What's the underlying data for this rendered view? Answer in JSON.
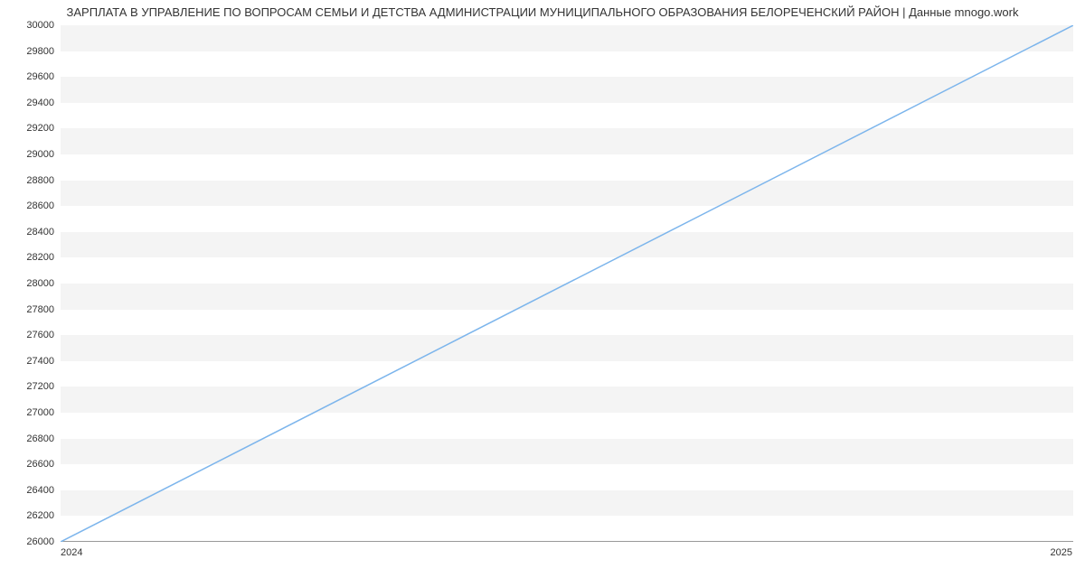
{
  "chart_data": {
    "type": "line",
    "title": "ЗАРПЛАТА В УПРАВЛЕНИЕ ПО ВОПРОСАМ СЕМЬИ И ДЕТСТВА АДМИНИСТРАЦИИ МУНИЦИПАЛЬНОГО ОБРАЗОВАНИЯ БЕЛОРЕЧЕНСКИЙ РАЙОН | Данные mnogo.work",
    "x": [
      "2024",
      "2025"
    ],
    "values": [
      26000,
      30000
    ],
    "ylim": [
      26000,
      30000
    ],
    "y_ticks": [
      26000,
      26200,
      26400,
      26600,
      26800,
      27000,
      27200,
      27400,
      27600,
      27800,
      28000,
      28200,
      28400,
      28600,
      28800,
      29000,
      29200,
      29400,
      29600,
      29800,
      30000
    ],
    "xlabel": "",
    "ylabel": ""
  },
  "x_labels": {
    "start": "2024",
    "end": "2025"
  }
}
